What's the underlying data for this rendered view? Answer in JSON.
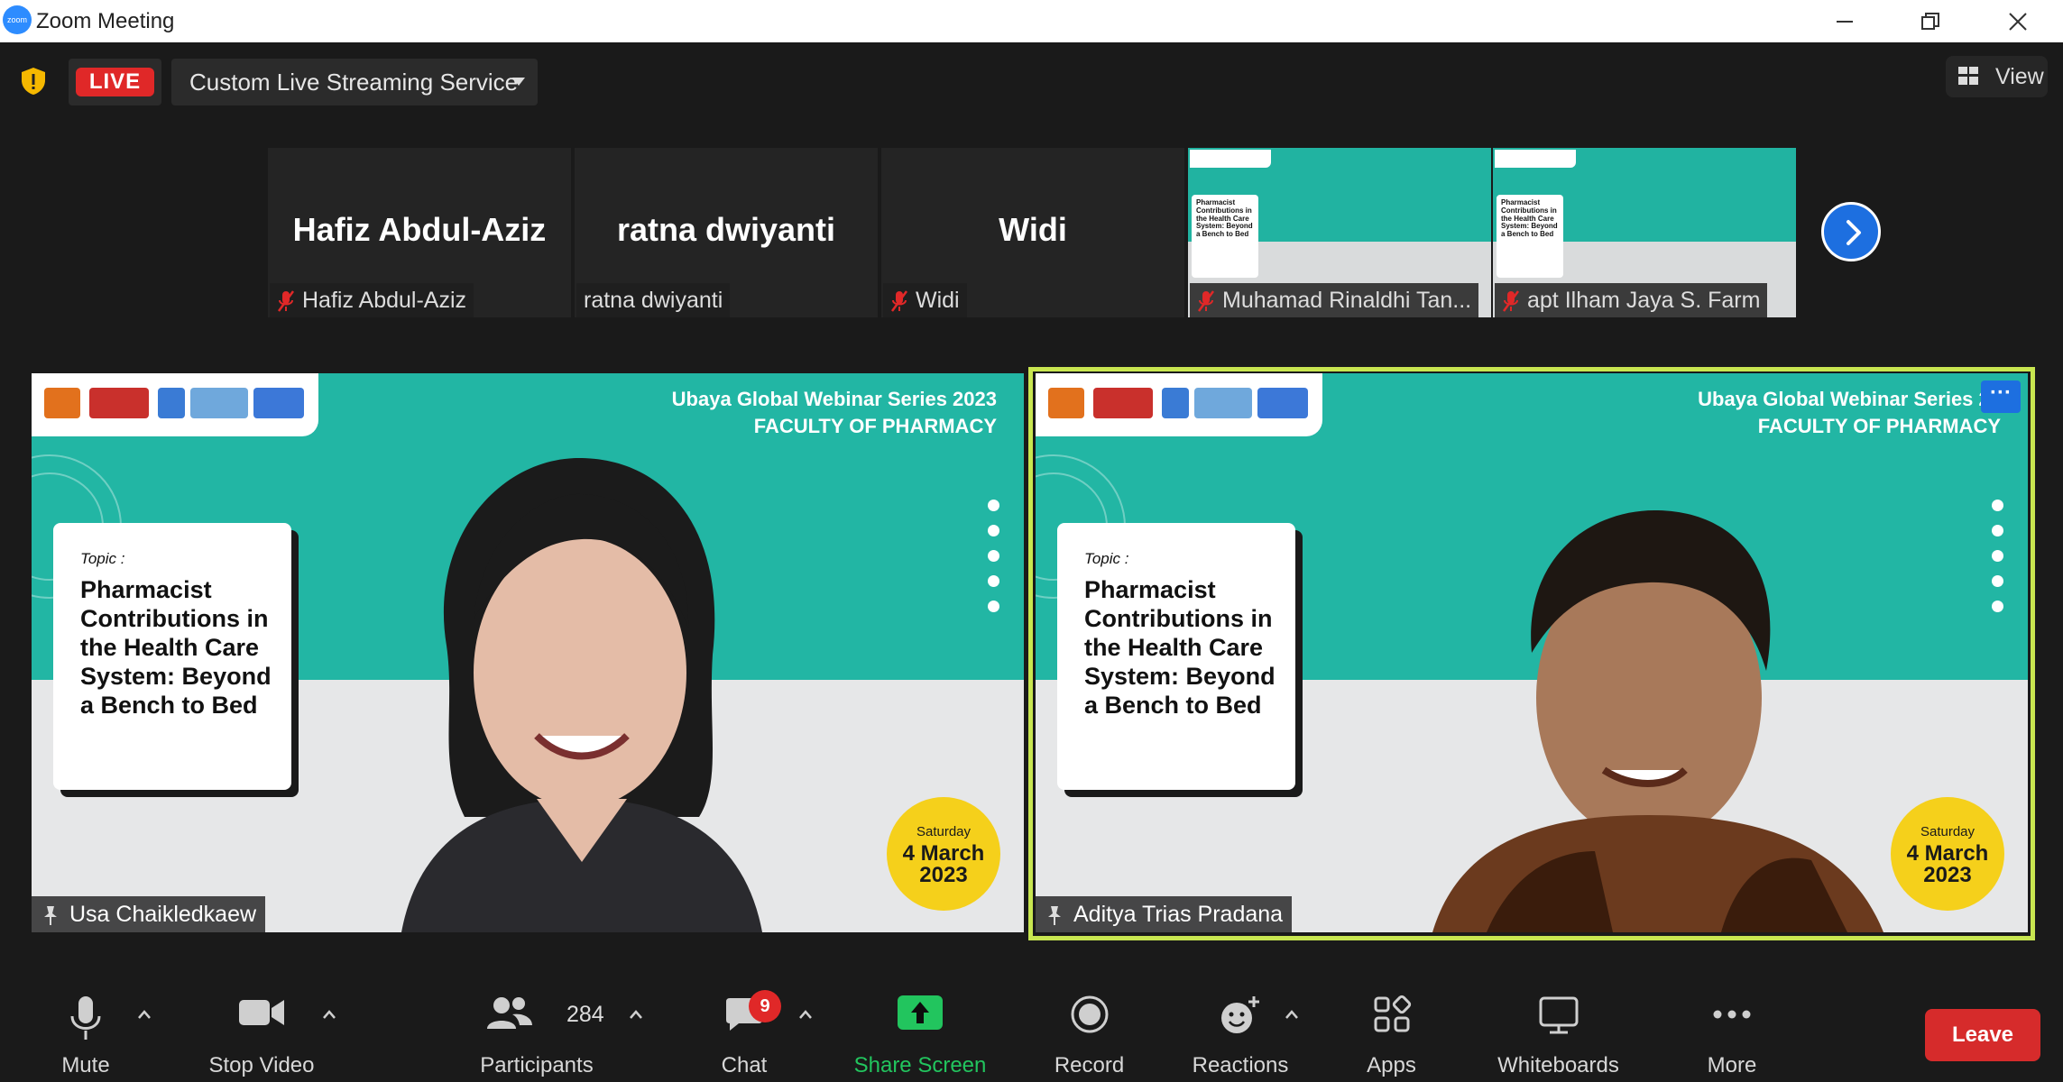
{
  "window": {
    "title": "Zoom Meeting",
    "logo_text": "zoom"
  },
  "topbar": {
    "live_label": "LIVE",
    "stream_service": "Custom Live Streaming Service",
    "view_label": "View"
  },
  "thumbnails": [
    {
      "big_name": "Hafiz Abdul-Aziz",
      "label": "Hafiz Abdul-Aziz",
      "muted": true
    },
    {
      "big_name": "ratna dwiyanti",
      "label": "ratna dwiyanti",
      "muted": false
    },
    {
      "big_name": "Widi",
      "label": "Widi",
      "muted": true
    },
    {
      "label": "Muhamad Rinaldhi Tan...",
      "muted": true
    },
    {
      "label": "apt Ilham Jaya S. Farm",
      "muted": true
    }
  ],
  "slide": {
    "header_line1": "Ubaya Global Webinar Series 2023",
    "header_line2": "FACULTY OF PHARMACY",
    "header_line1_cut": "Ubaya Global Webinar Series 20",
    "topic_label": "Topic :",
    "topic_text": "Pharmacist Contributions in the Health Care System: Beyond a Bench to Bed",
    "day": "Saturday",
    "date_line1": "4 March",
    "date_line2": "2023",
    "thumb_topic": "Pharmacist Contributions in the Health Care System: Beyond a Bench to Bed"
  },
  "tiles": [
    {
      "name": "Usa Chaikledkaew"
    },
    {
      "name": "Aditya Trias Pradana"
    }
  ],
  "toolbar": {
    "mute": "Mute",
    "stop_video": "Stop Video",
    "participants": "Participants",
    "participants_count": "284",
    "chat": "Chat",
    "chat_badge": "9",
    "share_screen": "Share Screen",
    "record": "Record",
    "reactions": "Reactions",
    "apps": "Apps",
    "whiteboards": "Whiteboards",
    "more": "More",
    "leave": "Leave"
  },
  "colors": {
    "live_red": "#e02828",
    "teal": "#22b6a4",
    "active_speaker": "#c8e650",
    "share_green": "#22c55e",
    "date_yellow": "#f5d01b"
  }
}
